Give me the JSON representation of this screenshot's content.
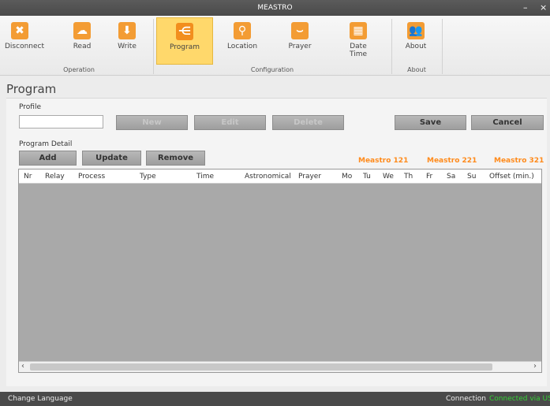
{
  "window": {
    "title": "MEASTRO",
    "minimize": "–",
    "close": "×"
  },
  "ribbon": {
    "buttons": [
      {
        "label": "Disconnect",
        "icon": "✖"
      },
      {
        "label": "Read",
        "icon": "☁"
      },
      {
        "label": "Write",
        "icon": "⬇"
      },
      {
        "label": "Program",
        "icon": "⋲"
      },
      {
        "label": "Location",
        "icon": "⚲"
      },
      {
        "label": "Prayer",
        "icon": "⌣"
      },
      {
        "label": "Date Time",
        "icon": "▦"
      },
      {
        "label": "About",
        "icon": "👥"
      }
    ],
    "groups": [
      "Operation",
      "Configuration",
      "About"
    ]
  },
  "page": {
    "title": "Program",
    "profile_label": "Profile",
    "profile_value": "",
    "program_detail_label": "Program Detail"
  },
  "buttons": {
    "new": "New",
    "edit": "Edit",
    "delete": "Delete",
    "save": "Save",
    "cancel": "Cancel",
    "add": "Add",
    "update": "Update",
    "remove": "Remove"
  },
  "models": [
    "Meastro 121",
    "Meastro 221",
    "Meastro 321"
  ],
  "table": {
    "columns": [
      "Nr",
      "Relay",
      "Process",
      "Type",
      "Time",
      "Astronomical",
      "Prayer",
      "Mo",
      "Tu",
      "We",
      "Th",
      "Fr",
      "Sa",
      "Su",
      "Offset (min.)"
    ]
  },
  "status": {
    "change_language": "Change Language",
    "connection_label": "Connection",
    "connection_value": "Connected via USB"
  },
  "colors": {
    "accent": "#ff8a1a",
    "active_tab": "#ffd86b",
    "connected": "#34d034"
  }
}
